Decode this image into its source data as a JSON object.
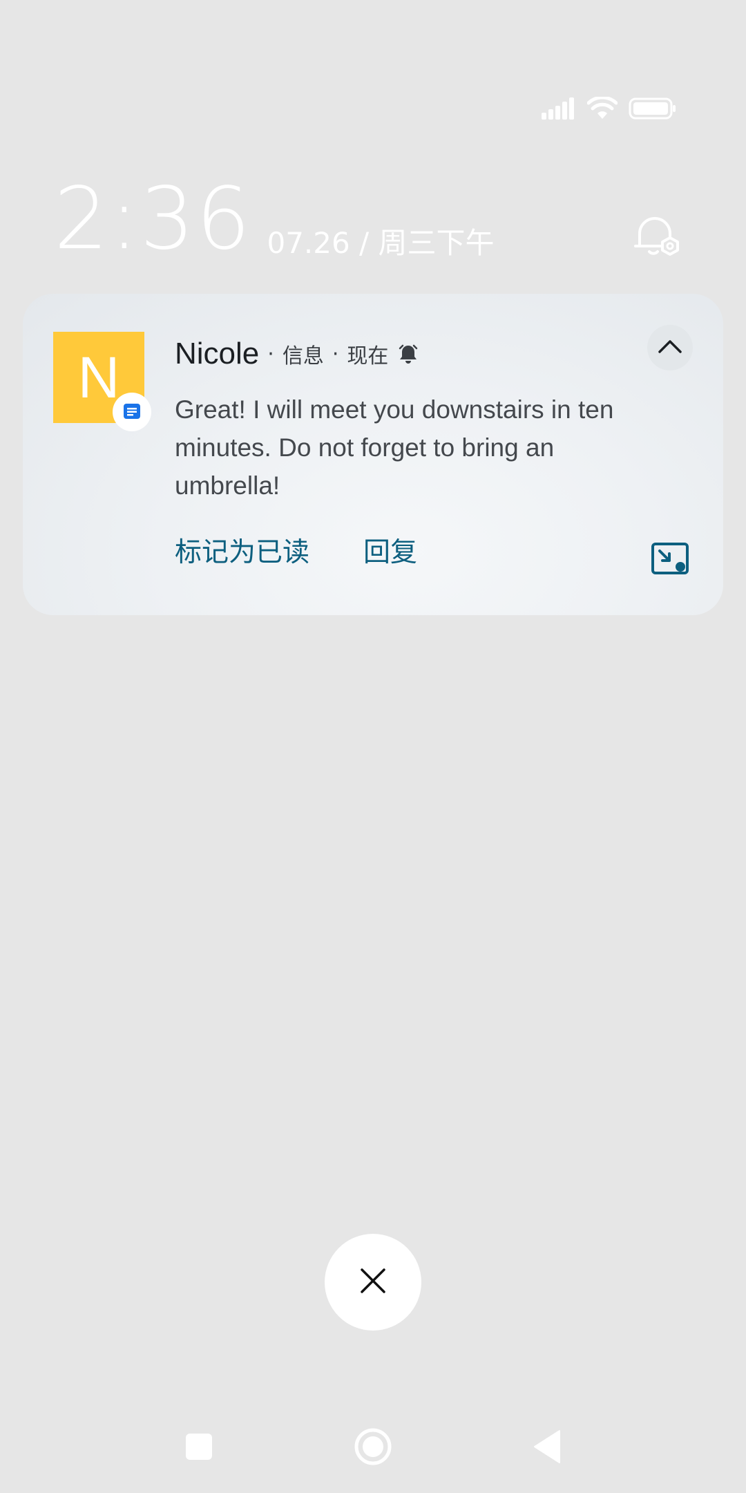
{
  "status_bar": {
    "icons": [
      "signal-icon",
      "wifi-icon",
      "battery-icon"
    ]
  },
  "lock_screen": {
    "time": "2:36",
    "date": "07.26 / 周三下午",
    "alarm_icon": "alarm-settings-icon"
  },
  "notification": {
    "avatar_letter": "N",
    "avatar_color": "#ffc93a",
    "app_badge_icon": "messages-icon",
    "sender": "Nicole",
    "app_name": "信息",
    "time_label": "现在",
    "bell_icon": "bell-icon",
    "message": "Great! I will meet you downstairs in ten minutes. Do not forget to bring an umbrella!",
    "actions": {
      "mark_read": "标记为已读",
      "reply": "回复"
    },
    "accent_color": "#0d5f7f"
  },
  "dismiss": {
    "icon": "close-icon"
  },
  "nav_bar": {
    "icons": [
      "recents-icon",
      "home-icon",
      "back-icon"
    ]
  }
}
